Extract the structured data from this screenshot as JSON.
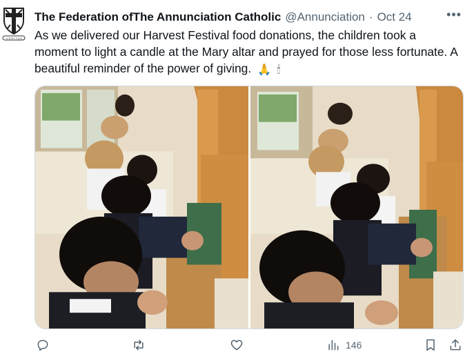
{
  "tweet": {
    "author_name": "The Federation ofThe Annunciation Catholic",
    "handle": "@Annunciation",
    "separator": "·",
    "time": "Oct 24",
    "text": "As we delivered our Harvest Festival food donations, the children took a moment to light a candle at the Mary altar and prayed for those less fortunate. A beautiful reminder of the power of giving.",
    "emojis": [
      "🙏",
      "🕯"
    ],
    "avatar_motto": "VERITAS"
  },
  "actions": {
    "views_count": "146"
  },
  "colors": {
    "text": "#0f1419",
    "secondary": "#536471",
    "border": "#cfd9de"
  },
  "icons": [
    "more-icon",
    "reply-icon",
    "retweet-icon",
    "like-icon",
    "views-icon",
    "bookmark-icon",
    "share-icon"
  ]
}
